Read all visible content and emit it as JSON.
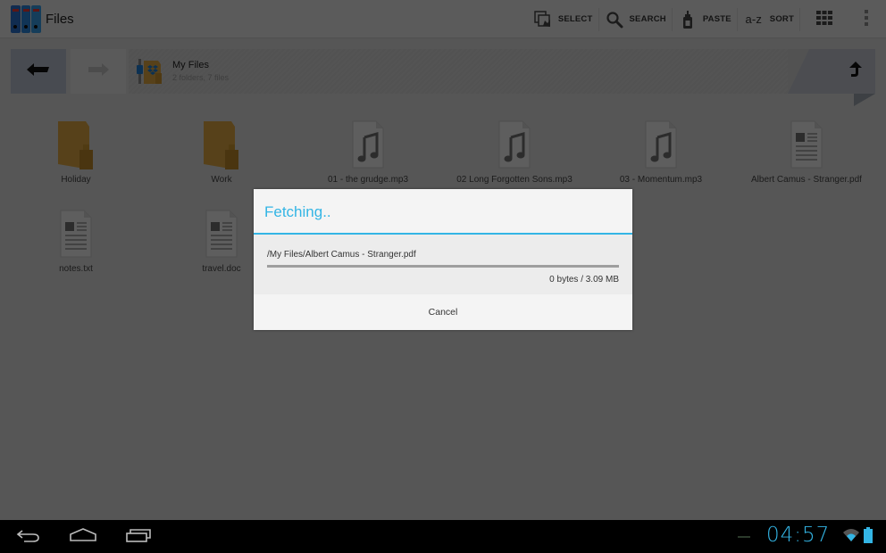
{
  "app": {
    "title": "Files",
    "icon": "binders-app-icon"
  },
  "actionbar": {
    "actions": [
      {
        "label": "SELECT",
        "icon": "select-icon"
      },
      {
        "label": "SEARCH",
        "icon": "search-icon"
      },
      {
        "label": "PASTE",
        "icon": "paste-glue-icon"
      },
      {
        "label": "SORT",
        "icon": "sort-az-icon",
        "icon_text": "a-z"
      }
    ],
    "view_toggle_icon": "grid-view-icon",
    "overflow_icon": "overflow-menu-icon"
  },
  "navbar": {
    "back_icon": "back-arrow-icon",
    "forward_icon": "forward-arrow-icon",
    "up_icon": "up-arrow-icon",
    "breadcrumb": {
      "title": "My Files",
      "subtitle": "2 folders, 7 files",
      "icon": "dropbox-folder-icon"
    }
  },
  "files": [
    {
      "name": "Holiday",
      "type": "folder"
    },
    {
      "name": "Work",
      "type": "folder"
    },
    {
      "name": "01 - the grudge.mp3",
      "type": "audio"
    },
    {
      "name": "02 Long Forgotten Sons.mp3",
      "type": "audio"
    },
    {
      "name": "03 - Momentum.mp3",
      "type": "audio"
    },
    {
      "name": "Albert Camus - Stranger.pdf",
      "type": "document"
    },
    {
      "name": "notes.txt",
      "type": "document"
    },
    {
      "name": "travel.doc",
      "type": "document"
    }
  ],
  "dialog": {
    "title": "Fetching..",
    "path": "/My Files/Albert Camus - Stranger.pdf",
    "progress_percent": 0,
    "size_text": "0 bytes / 3.09 MB",
    "cancel_label": "Cancel"
  },
  "system_bar": {
    "time": "04:57",
    "back_icon": "nav-back-icon",
    "home_icon": "nav-home-icon",
    "recents_icon": "nav-recents-icon",
    "wifi_icon": "wifi-icon",
    "battery_icon": "battery-icon"
  },
  "colors": {
    "accent": "#33b5e5",
    "folder": "#d9a441"
  }
}
